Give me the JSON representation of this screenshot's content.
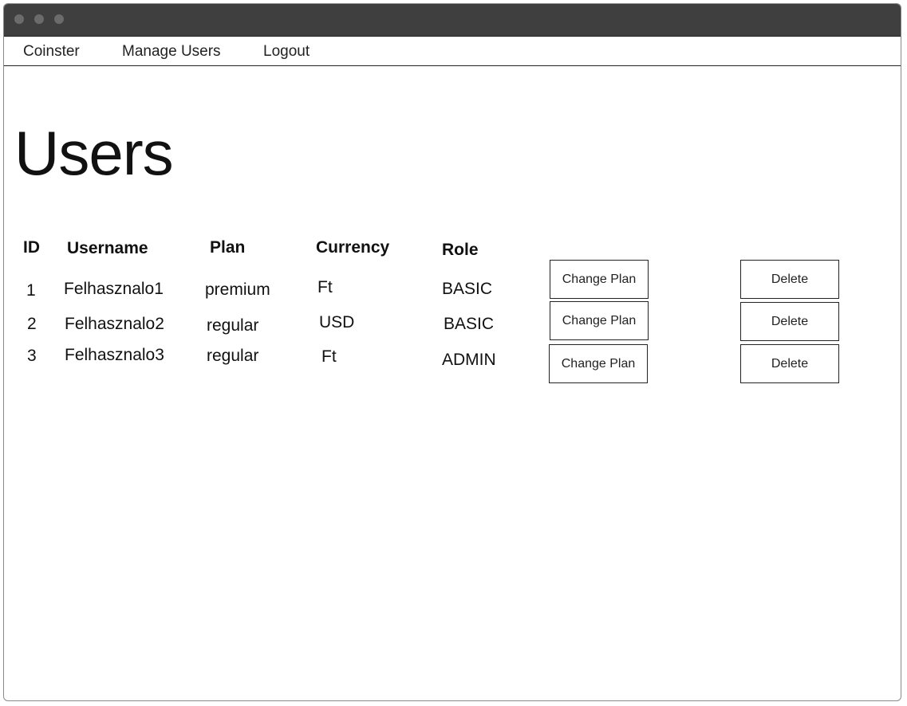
{
  "navbar": {
    "brand": "Coinster",
    "manage_users": "Manage Users",
    "logout": "Logout"
  },
  "page": {
    "title": "Users"
  },
  "table": {
    "headers": {
      "id": "ID",
      "username": "Username",
      "plan": "Plan",
      "currency": "Currency",
      "role": "Role"
    },
    "rows": [
      {
        "id": "1",
        "username": "Felhasznalo1",
        "plan": "premium",
        "currency": "Ft",
        "role": "BASIC",
        "change_plan": "Change Plan",
        "delete": "Delete"
      },
      {
        "id": "2",
        "username": "Felhasznalo2",
        "plan": "regular",
        "currency": "USD",
        "role": "BASIC",
        "change_plan": "Change Plan",
        "delete": "Delete"
      },
      {
        "id": "3",
        "username": "Felhasznalo3",
        "plan": "regular",
        "currency": "Ft",
        "role": "ADMIN",
        "change_plan": "Change Plan",
        "delete": "Delete"
      }
    ]
  }
}
